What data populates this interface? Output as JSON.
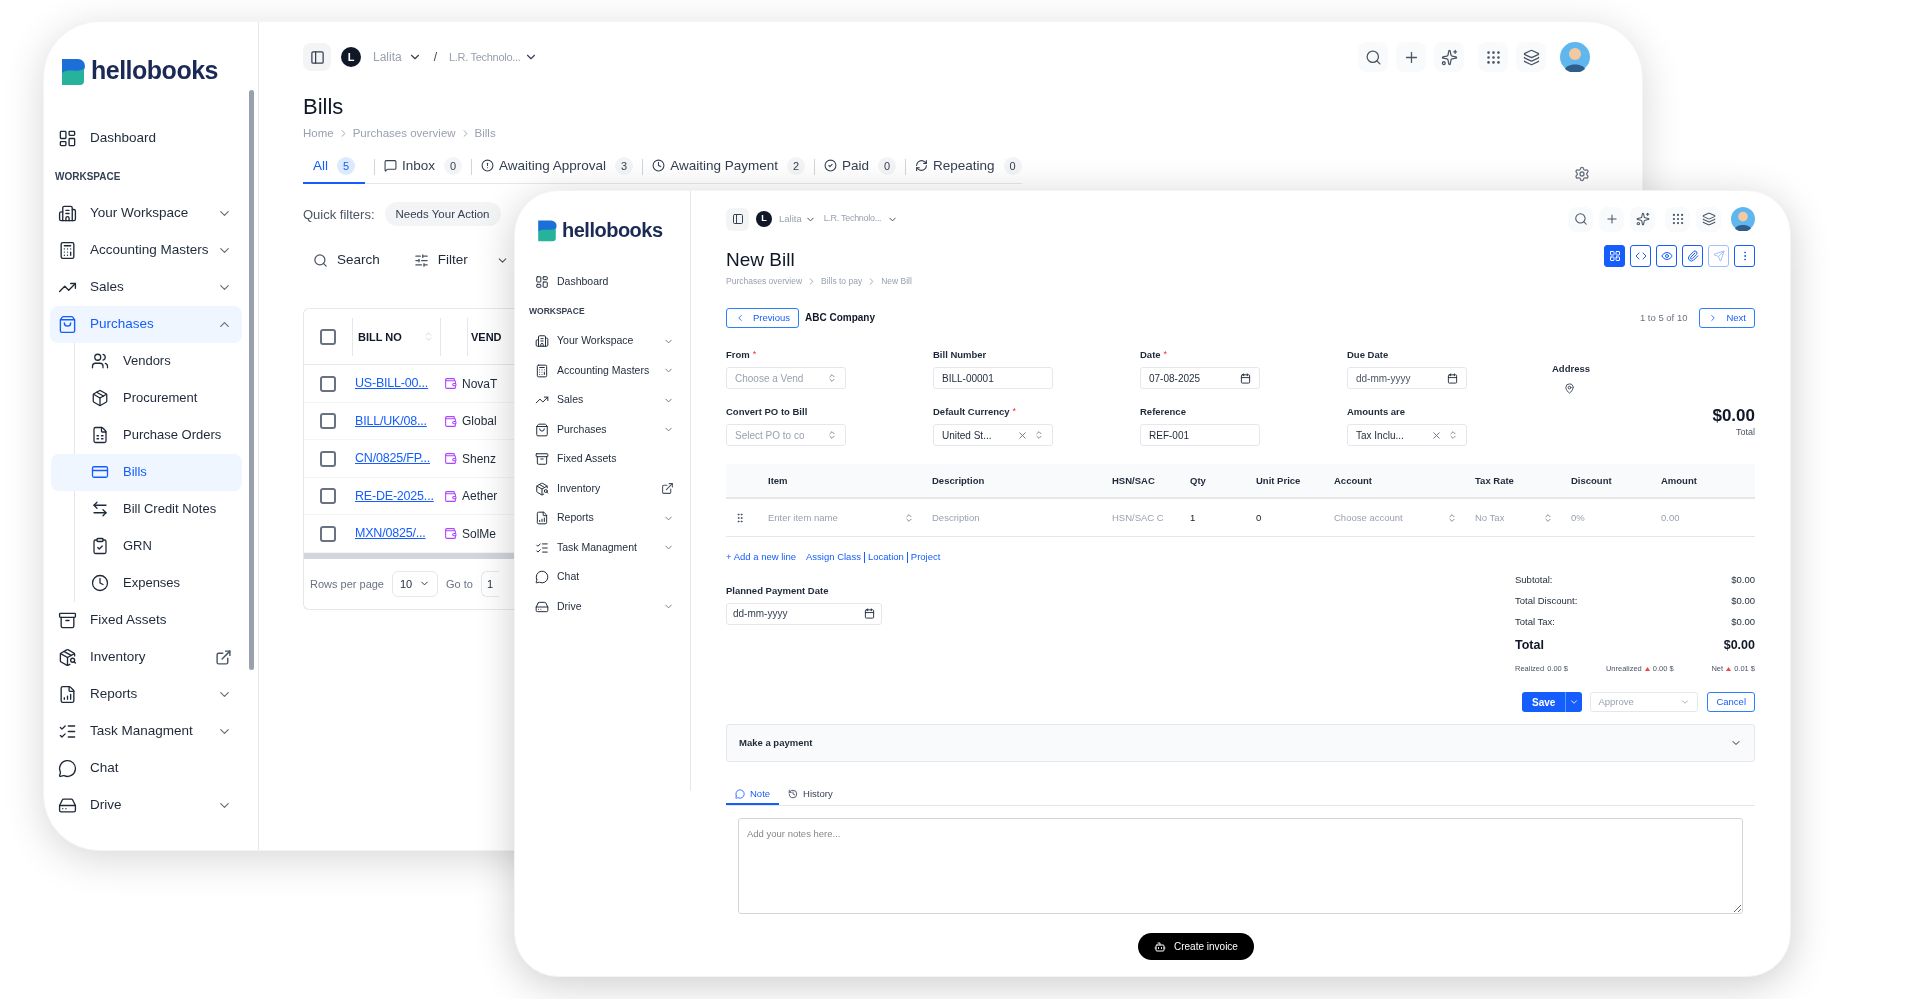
{
  "back_window": {
    "logo": "hellobooks",
    "sidebar": {
      "items": [
        {
          "kind": "link",
          "label": "Dashboard",
          "selected": false
        },
        {
          "kind": "section",
          "label": "WORKSPACE"
        },
        {
          "kind": "menu",
          "label": "Your Workspace",
          "selected": false,
          "expanded": false
        },
        {
          "kind": "menu",
          "label": "Accounting Masters",
          "selected": false,
          "expanded": false
        },
        {
          "kind": "menu",
          "label": "Sales",
          "selected": false,
          "expanded": false
        },
        {
          "kind": "menu",
          "label": "Purchases",
          "selected": true,
          "expanded": true,
          "children": [
            {
              "label": "Vendors",
              "selected": false
            },
            {
              "label": "Procurement",
              "selected": false
            },
            {
              "label": "Purchase Orders",
              "selected": false
            },
            {
              "label": "Bills",
              "selected": true
            },
            {
              "label": "Bill Credit Notes",
              "selected": false
            },
            {
              "label": "GRN",
              "selected": false
            },
            {
              "label": "Expenses",
              "selected": false
            }
          ]
        },
        {
          "kind": "link",
          "label": "Fixed Assets",
          "selected": false
        },
        {
          "kind": "external",
          "label": "Inventory",
          "selected": false
        },
        {
          "kind": "menu",
          "label": "Reports",
          "selected": false,
          "expanded": false
        },
        {
          "kind": "menu",
          "label": "Task Managment",
          "selected": false,
          "expanded": false
        },
        {
          "kind": "link",
          "label": "Chat",
          "selected": false
        },
        {
          "kind": "menu",
          "label": "Drive",
          "selected": false,
          "expanded": false
        }
      ]
    },
    "topbar": {
      "initial": "L",
      "user": "Lalita",
      "separator": "/",
      "company": "L.R. Technolo..."
    },
    "title": "Bills",
    "breadcrumb": [
      "Home",
      "Purchases overview",
      "Bills"
    ],
    "tabs": [
      {
        "label": "All",
        "count": "5",
        "selected": true
      },
      {
        "label": "Inbox",
        "count": "0",
        "selected": false
      },
      {
        "label": "Awaiting Approval",
        "count": "3",
        "selected": false
      },
      {
        "label": "Awaiting Payment",
        "count": "2",
        "selected": false
      },
      {
        "label": "Paid",
        "count": "0",
        "selected": false
      },
      {
        "label": "Repeating",
        "count": "0",
        "selected": false
      }
    ],
    "quick_filters": {
      "label": "Quick filters:",
      "chips": [
        "Needs Your Action"
      ]
    },
    "search": "Search",
    "filter": "Filter",
    "table": {
      "select_all_checked": false,
      "columns": [
        "BILL NO",
        "VEND"
      ],
      "rows": [
        {
          "bill_no": "US-BILL-00...",
          "vendor": "NovaT",
          "checked": false
        },
        {
          "bill_no": "BILL/UK/08...",
          "vendor": "Global",
          "checked": false
        },
        {
          "bill_no": "CN/0825/FP...",
          "vendor": "Shenz",
          "checked": false
        },
        {
          "bill_no": "RE-DE-2025...",
          "vendor": "Aether",
          "checked": false
        },
        {
          "bill_no": "MXN/0825/...",
          "vendor": "SolMe",
          "checked": false
        }
      ]
    },
    "pagination": {
      "rows_label": "Rows per page",
      "rows_value": "10",
      "goto_label": "Go to",
      "page": "1"
    }
  },
  "front_window": {
    "logo": "hellobooks",
    "sidebar": {
      "items": [
        {
          "kind": "link",
          "label": "Dashboard",
          "selected": false
        },
        {
          "kind": "section",
          "label": "WORKSPACE"
        },
        {
          "kind": "menu",
          "label": "Your Workspace",
          "selected": false,
          "expanded": false
        },
        {
          "kind": "menu",
          "label": "Accounting Masters",
          "selected": false,
          "expanded": false
        },
        {
          "kind": "menu",
          "label": "Sales",
          "selected": false,
          "expanded": false
        },
        {
          "kind": "menu",
          "label": "Purchases",
          "selected": false,
          "expanded": false
        },
        {
          "kind": "link",
          "label": "Fixed Assets",
          "selected": false
        },
        {
          "kind": "external",
          "label": "Inventory",
          "selected": false
        },
        {
          "kind": "menu",
          "label": "Reports",
          "selected": false,
          "expanded": false
        },
        {
          "kind": "menu",
          "label": "Task Managment",
          "selected": false,
          "expanded": false
        },
        {
          "kind": "link",
          "label": "Chat",
          "selected": false
        },
        {
          "kind": "menu",
          "label": "Drive",
          "selected": false,
          "expanded": false
        }
      ]
    },
    "topbar": {
      "initial": "L",
      "user": "Lalita",
      "company": "L.R. Technolo..."
    },
    "title": "New Bill",
    "breadcrumb": [
      "Purchases overview",
      "Bills to pay",
      "New Bill"
    ],
    "toolbar": [
      {
        "selected": true,
        "disabled": false
      },
      {
        "selected": false,
        "disabled": false
      },
      {
        "selected": false,
        "disabled": false
      },
      {
        "selected": false,
        "disabled": false
      },
      {
        "selected": false,
        "disabled": true
      },
      {
        "selected": false,
        "disabled": false
      }
    ],
    "nav": {
      "previous": "Previous",
      "company": "ABC Company",
      "range": "1 to 5 of 10",
      "next": "Next"
    },
    "fields": [
      {
        "kind": "select",
        "label": "From",
        "required_mark": "*",
        "placeholder": "Choose a Vend"
      },
      {
        "kind": "text",
        "label": "Bill Number",
        "value": "BILL-00001"
      },
      {
        "kind": "date",
        "label": "Date",
        "required_mark": "*",
        "value": "07-08-2025"
      },
      {
        "kind": "date",
        "label": "Due Date",
        "placeholder": "dd-mm-yyyy"
      },
      {
        "kind": "select",
        "label": "Convert PO to Bill",
        "placeholder": "Select PO to co"
      },
      {
        "kind": "clearable",
        "label": "Default Currency",
        "required_mark": "*",
        "value": "United St..."
      },
      {
        "kind": "text",
        "label": "Reference",
        "value": "REF-001"
      },
      {
        "kind": "clearable",
        "label": "Amounts are",
        "value": "Tax Inclu..."
      }
    ],
    "address_label": "Address",
    "total": {
      "amount": "$0.00",
      "label": "Total"
    },
    "lines": {
      "columns": [
        "Item",
        "Description",
        "HSN/SAC",
        "Qty",
        "Unit Price",
        "Account",
        "Tax Rate",
        "Discount",
        "Amount"
      ],
      "row": [
        {
          "kind": "select",
          "placeholder": "Enter item name"
        },
        {
          "kind": "input",
          "placeholder": "Description"
        },
        {
          "kind": "input",
          "placeholder": "HSN/SAC C"
        },
        {
          "kind": "value",
          "value": "1"
        },
        {
          "kind": "value",
          "value": "0"
        },
        {
          "kind": "select",
          "placeholder": "Choose account"
        },
        {
          "kind": "select",
          "placeholder": "No Tax"
        },
        {
          "kind": "input",
          "placeholder": "0%"
        },
        {
          "kind": "muted",
          "value": "0.00"
        }
      ]
    },
    "line_links": {
      "add": "+ Add a new line",
      "assign": [
        "Assign Class",
        "Location",
        "Project"
      ]
    },
    "planned_payment": {
      "label": "Planned Payment Date",
      "placeholder": "dd-mm-yyyy"
    },
    "summary": [
      {
        "label": "Subtotal:",
        "value": "$0.00"
      },
      {
        "label": "Total Discount:",
        "value": "$0.00"
      },
      {
        "label": "Total Tax:",
        "value": "$0.00"
      }
    ],
    "grand_total": {
      "label": "Total",
      "value": "$0.00"
    },
    "gains": [
      {
        "label": "Realized",
        "value": "0.00 $",
        "up": false
      },
      {
        "label": "Unrealized",
        "value": "0.00 $",
        "up": true
      },
      {
        "label": "Net",
        "value": "0.01 $",
        "up": true
      }
    ],
    "actions": {
      "save": "Save",
      "approve_placeholder": "Approve",
      "cancel": "Cancel"
    },
    "payment": {
      "label": "Make a payment",
      "expanded": false
    },
    "note_tabs": [
      {
        "label": "Note",
        "selected": true
      },
      {
        "label": "History",
        "selected": false
      }
    ],
    "notes_placeholder": "Add your notes here...",
    "create_invoice": "Create invoice"
  }
}
